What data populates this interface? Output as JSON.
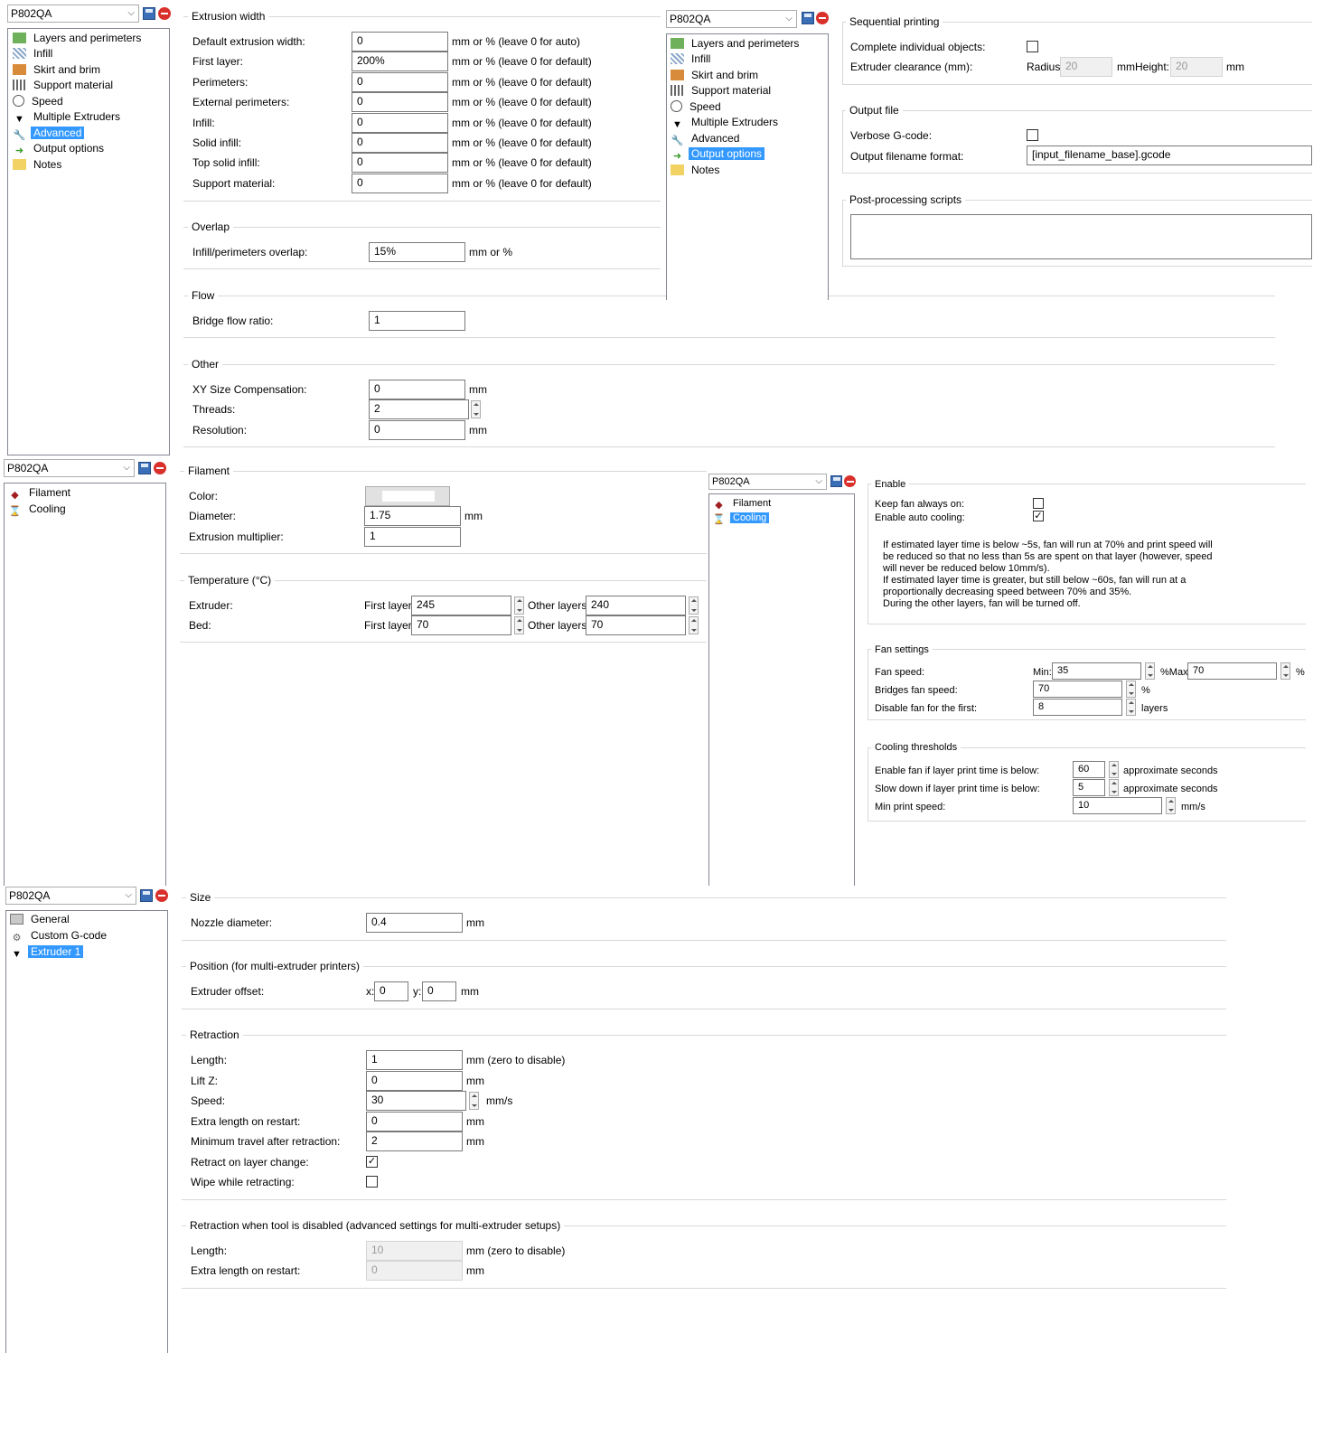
{
  "preset": "P802QA",
  "print_tree": [
    {
      "label": "Layers and perimeters",
      "icon": "layers-icon"
    },
    {
      "label": "Infill",
      "icon": "infill-icon"
    },
    {
      "label": "Skirt and brim",
      "icon": "skirt-icon"
    },
    {
      "label": "Support material",
      "icon": "support-icon"
    },
    {
      "label": "Speed",
      "icon": "speed-icon"
    },
    {
      "label": "Multiple Extruders",
      "icon": "funnel-icon"
    },
    {
      "label": "Advanced",
      "icon": "wrench-icon"
    },
    {
      "label": "Output options",
      "icon": "output-icon"
    },
    {
      "label": "Notes",
      "icon": "note-icon"
    }
  ],
  "advanced": {
    "extrusion_width": {
      "title": "Extrusion width",
      "rows": [
        {
          "label": "Default extrusion width:",
          "value": "0",
          "unit": "mm or % (leave 0 for auto)"
        },
        {
          "label": "First layer:",
          "value": "200%",
          "unit": "mm or % (leave 0 for default)"
        },
        {
          "label": "Perimeters:",
          "value": "0",
          "unit": "mm or % (leave 0 for default)"
        },
        {
          "label": "External perimeters:",
          "value": "0",
          "unit": "mm or % (leave 0 for default)"
        },
        {
          "label": "Infill:",
          "value": "0",
          "unit": "mm or % (leave 0 for default)"
        },
        {
          "label": "Solid infill:",
          "value": "0",
          "unit": "mm or % (leave 0 for default)"
        },
        {
          "label": "Top solid infill:",
          "value": "0",
          "unit": "mm or % (leave 0 for default)"
        },
        {
          "label": "Support material:",
          "value": "0",
          "unit": "mm or % (leave 0 for default)"
        }
      ]
    },
    "overlap": {
      "title": "Overlap",
      "label": "Infill/perimeters overlap:",
      "value": "15%",
      "unit": "mm or %"
    },
    "flow": {
      "title": "Flow",
      "label": "Bridge flow ratio:",
      "value": "1"
    },
    "other": {
      "title": "Other",
      "rows": [
        {
          "label": "XY Size Compensation:",
          "value": "0",
          "unit": "mm"
        },
        {
          "label": "Threads:",
          "value": "2",
          "unit": ""
        },
        {
          "label": "Resolution:",
          "value": "0",
          "unit": "mm"
        }
      ]
    }
  },
  "output": {
    "sequential": {
      "title": "Sequential printing",
      "complete_label": "Complete individual objects:",
      "clearance_label": "Extruder clearance (mm):",
      "radius_label": "Radius:",
      "radius_value": "20",
      "height_label": "mmHeight:",
      "height_value": "20",
      "height_unit": "mm"
    },
    "file": {
      "title": "Output file",
      "verbose_label": "Verbose G-code:",
      "format_label": "Output filename format:",
      "format_value": "[input_filename_base].gcode"
    },
    "post": {
      "title": "Post-processing scripts"
    }
  },
  "filament_tree": [
    {
      "label": "Filament",
      "icon": "filament-icon"
    },
    {
      "label": "Cooling",
      "icon": "hourglass-icon"
    }
  ],
  "filament": {
    "title": "Filament",
    "color_label": "Color:",
    "diameter_label": "Diameter:",
    "diameter_value": "1.75",
    "diameter_unit": "mm",
    "mult_label": "Extrusion multiplier:",
    "mult_value": "1",
    "temp": {
      "title": "Temperature (°C)",
      "first_label": "First layer:",
      "other_label": "Other layers:",
      "rows": [
        {
          "label": "Extruder:",
          "first": "245",
          "other": "240"
        },
        {
          "label": "Bed:",
          "first": "70",
          "other": "70"
        }
      ]
    }
  },
  "cooling": {
    "enable": {
      "title": "Enable",
      "always_label": "Keep fan always on:",
      "auto_label": "Enable auto cooling:",
      "desc": [
        "If estimated layer time is below ~5s, fan will run at 70% and print speed will",
        "be reduced so that no less than 5s are spent on that layer (however, speed",
        "will never be reduced below 10mm/s).",
        "If estimated layer time is greater, but still below ~60s, fan will run at a",
        "proportionally decreasing speed between 70% and 35%.",
        "During the other layers, fan will be turned off."
      ]
    },
    "fan": {
      "title": "Fan settings",
      "speed_label": "Fan speed:",
      "min_label": "Min:",
      "min_value": "35",
      "max_label": "%Max:",
      "max_value": "70",
      "max_unit": "%",
      "bridges_label": "Bridges fan speed:",
      "bridges_value": "70",
      "bridges_unit": "%",
      "disable_label": "Disable fan for the first:",
      "disable_value": "8",
      "disable_unit": "layers"
    },
    "thresholds": {
      "title": "Cooling thresholds",
      "rows": [
        {
          "label": "Enable fan if layer print time is below:",
          "value": "60",
          "unit": "approximate seconds"
        },
        {
          "label": "Slow down if layer print time is below:",
          "value": "5",
          "unit": "approximate seconds"
        },
        {
          "label": "Min print speed:",
          "value": "10",
          "unit": "mm/s"
        }
      ]
    }
  },
  "printer_tree": [
    {
      "label": "General",
      "icon": "printer-icon"
    },
    {
      "label": "Custom G-code",
      "icon": "gear-icon"
    },
    {
      "label": "Extruder 1",
      "icon": "funnel-icon"
    }
  ],
  "printer": {
    "size": {
      "title": "Size",
      "label": "Nozzle diameter:",
      "value": "0.4",
      "unit": "mm"
    },
    "position": {
      "title": "Position (for multi-extruder printers)",
      "label": "Extruder offset:",
      "x_label": "x:",
      "x_value": "0",
      "y_label": "y:",
      "y_value": "0",
      "unit": "mm"
    },
    "retraction": {
      "title": "Retraction",
      "rows": [
        {
          "label": "Length:",
          "value": "1",
          "unit": "mm (zero to disable)"
        },
        {
          "label": "Lift Z:",
          "value": "0",
          "unit": "mm"
        },
        {
          "label": "Speed:",
          "value": "30",
          "unit": "mm/s"
        },
        {
          "label": "Extra length on restart:",
          "value": "0",
          "unit": "mm"
        },
        {
          "label": "Minimum travel after retraction:",
          "value": "2",
          "unit": "mm"
        }
      ],
      "layer_change_label": "Retract on layer change:",
      "wipe_label": "Wipe while retracting:"
    },
    "retraction_disabled": {
      "title": "Retraction when tool is disabled (advanced settings for multi-extruder setups)",
      "length_label": "Length:",
      "length_value": "10",
      "length_unit": "mm (zero to disable)",
      "extra_label": "Extra length on restart:",
      "extra_value": "0",
      "extra_unit": "mm"
    }
  },
  "colors": {
    "selection": "#3399ff",
    "border": "#828790",
    "group_line": "#d8d8d8"
  }
}
